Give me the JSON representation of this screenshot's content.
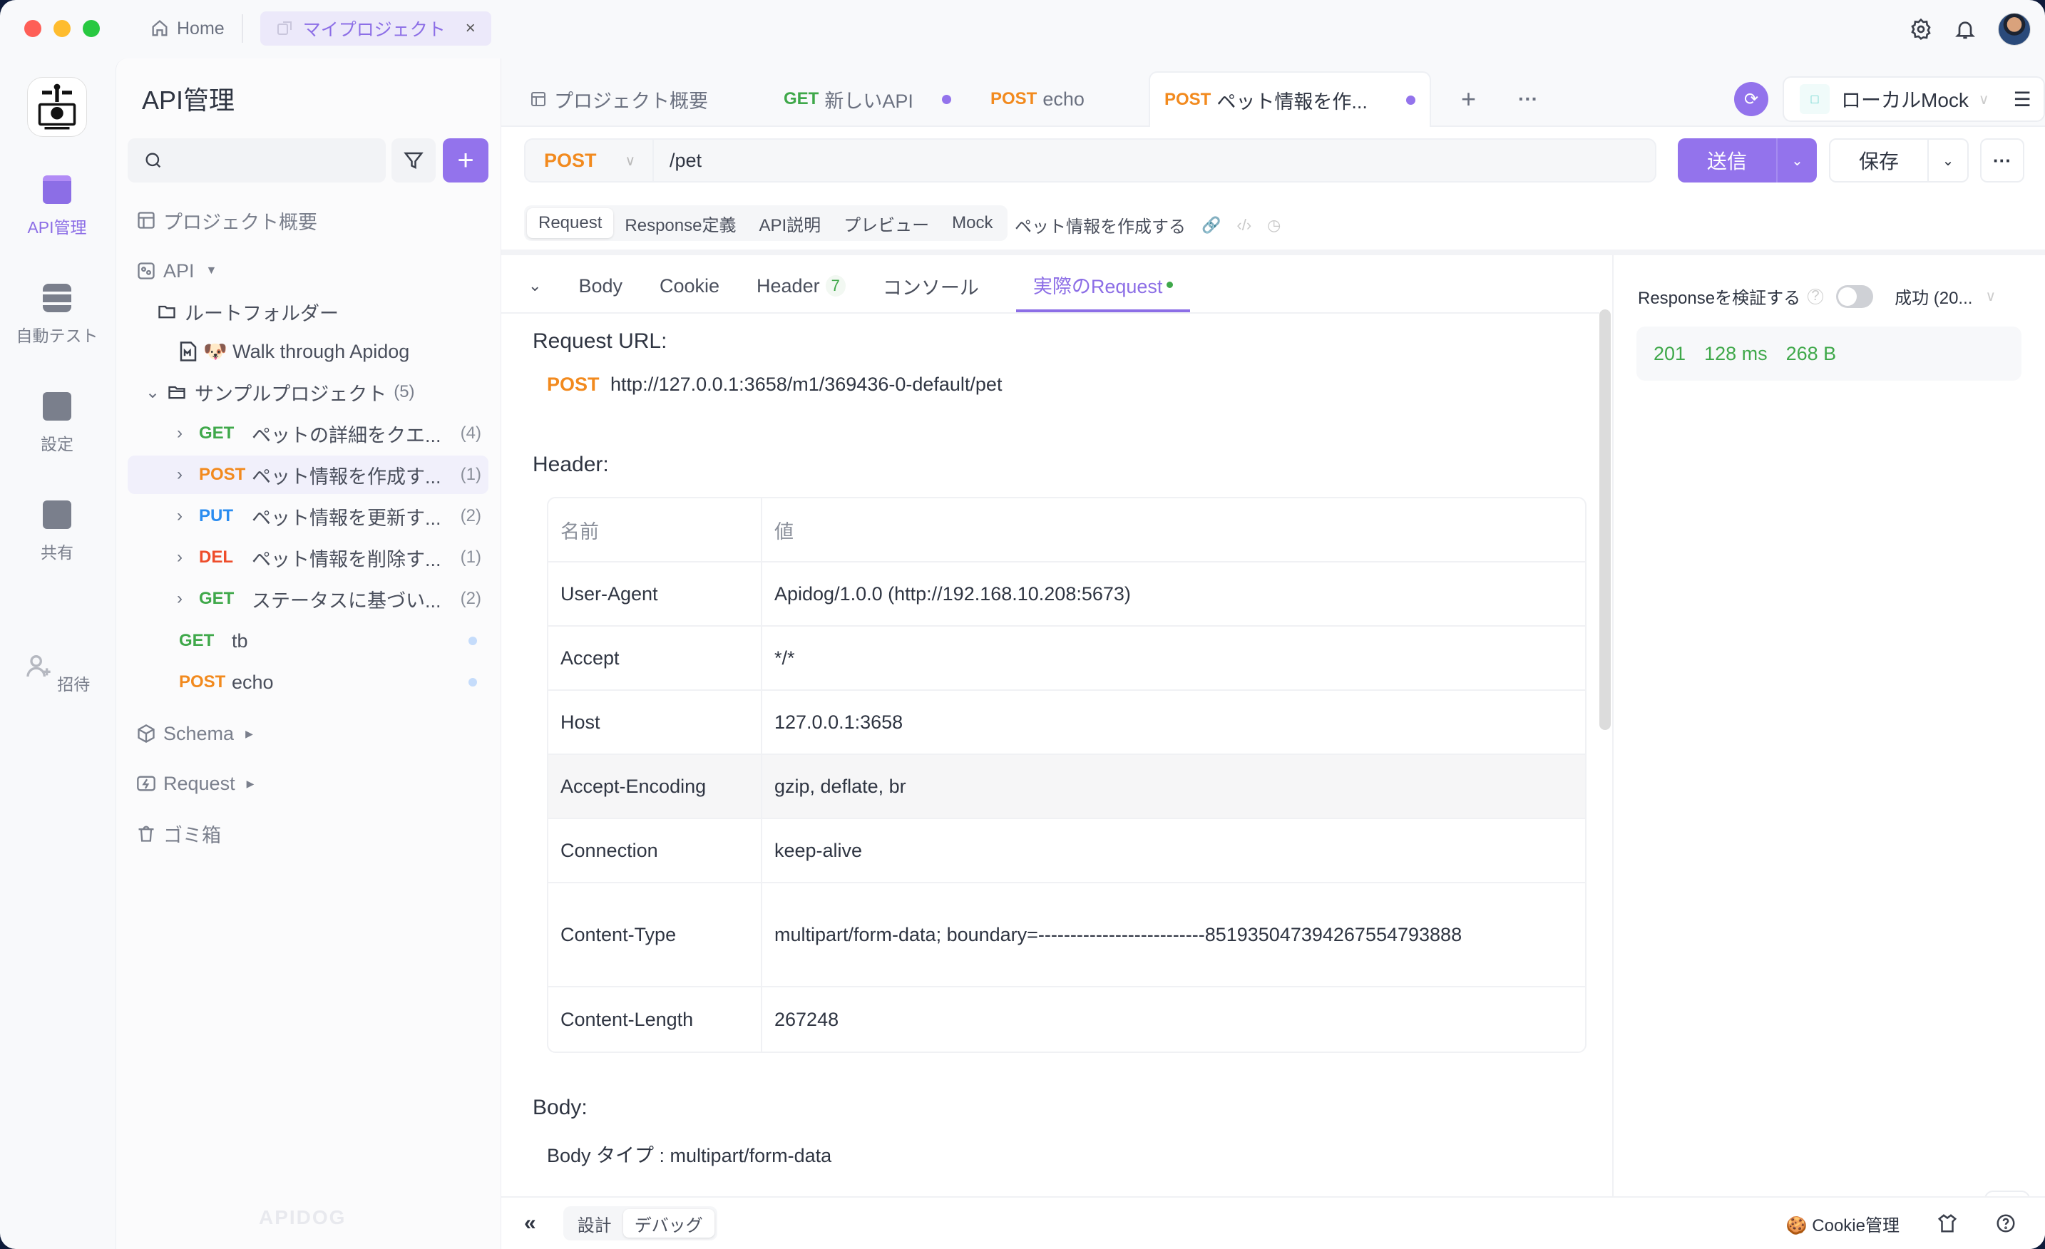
{
  "titlebar": {
    "home_label": "Home",
    "project_tab_label": "マイプロジェクト",
    "close_glyph": "×",
    "traffic_lights": {
      "close": "#fe5f57",
      "minimize": "#febc2e",
      "maximize": "#28c840"
    }
  },
  "rail": {
    "items": [
      {
        "label": "API管理",
        "icon": "api-icon",
        "active": true
      },
      {
        "label": "自動テスト",
        "icon": "automation-icon"
      },
      {
        "label": "設定",
        "icon": "settings-icon"
      },
      {
        "label": "共有",
        "icon": "share-icon"
      },
      {
        "label": "招待",
        "icon": "invite-icon"
      }
    ]
  },
  "sidebar": {
    "title": "API管理",
    "search_placeholder": "",
    "add_glyph": "+",
    "project_overview": "プロジェクト概要",
    "api_label": "API",
    "root_folder": "ルートフォルダー",
    "walkthrough": "🐶 Walk through Apidog",
    "sample_project": "サンプルプロジェクト",
    "sample_count": "(5)",
    "endpoints": [
      {
        "method": "GET",
        "name": "ペットの詳細をクエ...",
        "count": "(4)"
      },
      {
        "method": "POST",
        "name": "ペット情報を作成す...",
        "count": "(1)",
        "selected": true
      },
      {
        "method": "PUT",
        "name": "ペット情報を更新す...",
        "count": "(2)"
      },
      {
        "method": "DEL",
        "name": "ペット情報を削除す...",
        "count": "(1)"
      },
      {
        "method": "GET",
        "name": "ステータスに基づい...",
        "count": "(2)"
      }
    ],
    "loose_items": [
      {
        "method": "GET",
        "name": "tb"
      },
      {
        "method": "POST",
        "name": "echo"
      }
    ],
    "schema": "Schema",
    "request": "Request",
    "trash": "ゴミ箱",
    "watermark": "APIDOG"
  },
  "tabs": [
    {
      "method": "",
      "label": "プロジェクト概要"
    },
    {
      "method": "GET",
      "label": "新しいAPI",
      "dirty": true
    },
    {
      "method": "POST",
      "label": "echo"
    },
    {
      "method": "POST",
      "label": "ペット情報を作...",
      "dirty": true,
      "active": true
    }
  ],
  "env": {
    "label": "ローカルMock",
    "sq_glyph": "□"
  },
  "request_bar": {
    "method": "POST",
    "path": "/pet",
    "send": "送信",
    "save": "保存"
  },
  "subtabs": [
    "Request",
    "Response定義",
    "API説明",
    "プレビュー",
    "Mock"
  ],
  "api_name": "ペット情報を作成する",
  "response_tabs": [
    {
      "label": "Body"
    },
    {
      "label": "Cookie"
    },
    {
      "label": "Header",
      "badge": "7"
    },
    {
      "label": "コンソール"
    },
    {
      "label": "実際のRequest",
      "active": true
    }
  ],
  "actual_request": {
    "url_heading": "Request URL:",
    "method": "POST",
    "url": "http://127.0.0.1:3658/m1/369436-0-default/pet",
    "header_heading": "Header:",
    "columns": [
      "名前",
      "値"
    ],
    "headers": [
      {
        "name": "User-Agent",
        "value": "Apidog/1.0.0 (http://192.168.10.208:5673)"
      },
      {
        "name": "Accept",
        "value": "*/*"
      },
      {
        "name": "Host",
        "value": "127.0.0.1:3658"
      },
      {
        "name": "Accept-Encoding",
        "value": "gzip, deflate, br"
      },
      {
        "name": "Connection",
        "value": "keep-alive"
      },
      {
        "name": "Content-Type",
        "value": "multipart/form-data; boundary=--------------------------851935047394267554793888"
      },
      {
        "name": "Content-Length",
        "value": "267248"
      }
    ],
    "body_heading": "Body:",
    "body_type": "Body タイプ : multipart/form-data"
  },
  "response_panel": {
    "verify_label": "Responseを検証する",
    "verify_enabled": false,
    "result_select": "成功 (20...",
    "status": "201",
    "time": "128 ms",
    "size": "268 B"
  },
  "bottombar": {
    "design": "設計",
    "debug": "デバッグ",
    "cookie": "Cookie管理"
  }
}
